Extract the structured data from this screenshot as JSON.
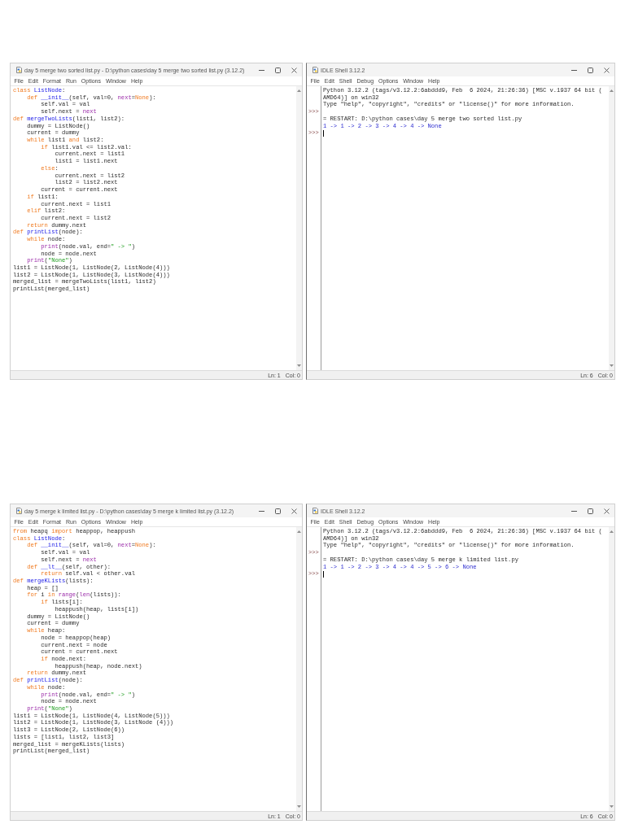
{
  "screens": [
    {
      "editor": {
        "title": "day 5 merge two sorted list.py - D:\\python cases\\day 5 merge two sorted list.py (3.12.2)",
        "menu": [
          "File",
          "Edit",
          "Format",
          "Run",
          "Options",
          "Window",
          "Help"
        ],
        "code": [
          [
            {
              "text": "class ",
              "kind": "keyword"
            },
            {
              "text": "ListNode",
              "kind": "definition"
            },
            {
              "text": ":",
              "kind": "plain"
            }
          ],
          [
            {
              "text": "    def ",
              "kind": "keyword"
            },
            {
              "text": "__init__",
              "kind": "definition"
            },
            {
              "text": "(self, val=0, ",
              "kind": "plain"
            },
            {
              "text": "next",
              "kind": "builtin"
            },
            {
              "text": "=",
              "kind": "plain"
            },
            {
              "text": "None",
              "kind": "keyword"
            },
            {
              "text": "):",
              "kind": "plain"
            }
          ],
          [
            {
              "text": "        self.val = val",
              "kind": "plain"
            }
          ],
          [
            {
              "text": "        self.next = ",
              "kind": "plain"
            },
            {
              "text": "next",
              "kind": "builtin"
            }
          ],
          [
            {
              "text": "def ",
              "kind": "keyword"
            },
            {
              "text": "mergeTwoLists",
              "kind": "definition"
            },
            {
              "text": "(list1, list2):",
              "kind": "plain"
            }
          ],
          [
            {
              "text": "    dummy = ListNode()",
              "kind": "plain"
            }
          ],
          [
            {
              "text": "    current = dummy",
              "kind": "plain"
            }
          ],
          [
            {
              "text": "    while ",
              "kind": "keyword"
            },
            {
              "text": "list1 ",
              "kind": "plain"
            },
            {
              "text": "and ",
              "kind": "keyword"
            },
            {
              "text": "list2:",
              "kind": "plain"
            }
          ],
          [
            {
              "text": "        if ",
              "kind": "keyword"
            },
            {
              "text": "list1.val <= list2.val:",
              "kind": "plain"
            }
          ],
          [
            {
              "text": "            current.next = list1",
              "kind": "plain"
            }
          ],
          [
            {
              "text": "            list1 = list1.next",
              "kind": "plain"
            }
          ],
          [
            {
              "text": "        else",
              "kind": "keyword"
            },
            {
              "text": ":",
              "kind": "plain"
            }
          ],
          [
            {
              "text": "            current.next = list2",
              "kind": "plain"
            }
          ],
          [
            {
              "text": "            list2 = list2.next",
              "kind": "plain"
            }
          ],
          [
            {
              "text": "        current = current.next",
              "kind": "plain"
            }
          ],
          [
            {
              "text": "    if ",
              "kind": "keyword"
            },
            {
              "text": "list1:",
              "kind": "plain"
            }
          ],
          [
            {
              "text": "        current.next = list1",
              "kind": "plain"
            }
          ],
          [
            {
              "text": "    elif ",
              "kind": "keyword"
            },
            {
              "text": "list2:",
              "kind": "plain"
            }
          ],
          [
            {
              "text": "        current.next = list2",
              "kind": "plain"
            }
          ],
          [
            {
              "text": "    return ",
              "kind": "keyword"
            },
            {
              "text": "dummy.next",
              "kind": "plain"
            }
          ],
          [
            {
              "text": "def ",
              "kind": "keyword"
            },
            {
              "text": "printList",
              "kind": "definition"
            },
            {
              "text": "(node):",
              "kind": "plain"
            }
          ],
          [
            {
              "text": "    while ",
              "kind": "keyword"
            },
            {
              "text": "node:",
              "kind": "plain"
            }
          ],
          [
            {
              "text": "        print",
              "kind": "builtin"
            },
            {
              "text": "(node.val, end=",
              "kind": "plain"
            },
            {
              "text": "\" -> \"",
              "kind": "string"
            },
            {
              "text": ")",
              "kind": "plain"
            }
          ],
          [
            {
              "text": "        node = node.next",
              "kind": "plain"
            }
          ],
          [
            {
              "text": "    print",
              "kind": "builtin"
            },
            {
              "text": "(",
              "kind": "plain"
            },
            {
              "text": "\"None\"",
              "kind": "string"
            },
            {
              "text": ")",
              "kind": "plain"
            }
          ],
          [
            {
              "text": "list1 = ListNode(1, ListNode(2, ListNode(4)))",
              "kind": "plain"
            }
          ],
          [
            {
              "text": "list2 = ListNode(1, ListNode(3, ListNode(4)))",
              "kind": "plain"
            }
          ],
          [
            {
              "text": "merged_list = mergeTwoLists(list1, list2)",
              "kind": "plain"
            }
          ],
          [
            {
              "text": "printList(merged_list)",
              "kind": "plain"
            }
          ]
        ],
        "status": {
          "line": "Ln: 1",
          "column": "Col: 0"
        }
      },
      "shell": {
        "title": "IDLE Shell 3.12.2",
        "menu": [
          "File",
          "Edit",
          "Shell",
          "Debug",
          "Options",
          "Window",
          "Help"
        ],
        "lines": [
          {
            "kind": "console",
            "text": "Python 3.12.2 (tags/v3.12.2:6abddd9, Feb  6 2024, 21:26:36) [MSC v.1937 64 bit ("
          },
          {
            "kind": "console",
            "text": "AMD64)] on win32"
          },
          {
            "kind": "console",
            "text": "Type \"help\", \"copyright\", \"credits\" or \"license()\" for more information."
          },
          {
            "kind": "prompt",
            "text": ">>>"
          },
          {
            "kind": "console",
            "text": "= RESTART: D:\\python cases\\day 5 merge two sorted list.py"
          },
          {
            "kind": "stdout",
            "text": "1 -> 1 -> 2 -> 3 -> 4 -> 4 -> None"
          },
          {
            "kind": "prompt",
            "text": ">>>"
          }
        ],
        "cursor": true,
        "status": {
          "line": "Ln: 6",
          "column": "Col: 0"
        }
      }
    },
    {
      "editor": {
        "title": "day 5 merge k limited list.py - D:\\python cases\\day 5 merge k limited list.py (3.12.2)",
        "menu": [
          "File",
          "Edit",
          "Format",
          "Run",
          "Options",
          "Window",
          "Help"
        ],
        "code": [
          [
            {
              "text": "from ",
              "kind": "keyword"
            },
            {
              "text": "heapq ",
              "kind": "plain"
            },
            {
              "text": "import ",
              "kind": "keyword"
            },
            {
              "text": "heappop, heappush",
              "kind": "plain"
            }
          ],
          [
            {
              "text": "class ",
              "kind": "keyword"
            },
            {
              "text": "ListNode",
              "kind": "definition"
            },
            {
              "text": ":",
              "kind": "plain"
            }
          ],
          [
            {
              "text": "    def ",
              "kind": "keyword"
            },
            {
              "text": "__init__",
              "kind": "definition"
            },
            {
              "text": "(self, val=0, ",
              "kind": "plain"
            },
            {
              "text": "next",
              "kind": "builtin"
            },
            {
              "text": "=",
              "kind": "plain"
            },
            {
              "text": "None",
              "kind": "keyword"
            },
            {
              "text": "):",
              "kind": "plain"
            }
          ],
          [
            {
              "text": "        self.val = val",
              "kind": "plain"
            }
          ],
          [
            {
              "text": "        self.next = ",
              "kind": "plain"
            },
            {
              "text": "next",
              "kind": "builtin"
            }
          ],
          [
            {
              "text": "    def ",
              "kind": "keyword"
            },
            {
              "text": "__lt__",
              "kind": "definition"
            },
            {
              "text": "(self, other):",
              "kind": "plain"
            }
          ],
          [
            {
              "text": "        return ",
              "kind": "keyword"
            },
            {
              "text": "self.val < other.val",
              "kind": "plain"
            }
          ],
          [
            {
              "text": "def ",
              "kind": "keyword"
            },
            {
              "text": "mergeKLists",
              "kind": "definition"
            },
            {
              "text": "(lists):",
              "kind": "plain"
            }
          ],
          [
            {
              "text": "    heap = []",
              "kind": "plain"
            }
          ],
          [
            {
              "text": "    for ",
              "kind": "keyword"
            },
            {
              "text": "i ",
              "kind": "plain"
            },
            {
              "text": "in ",
              "kind": "keyword"
            },
            {
              "text": "range",
              "kind": "builtin"
            },
            {
              "text": "(",
              "kind": "plain"
            },
            {
              "text": "len",
              "kind": "builtin"
            },
            {
              "text": "(lists)):",
              "kind": "plain"
            }
          ],
          [
            {
              "text": "        if ",
              "kind": "keyword"
            },
            {
              "text": "lists[i]:",
              "kind": "plain"
            }
          ],
          [
            {
              "text": "            heappush(heap, lists[i])",
              "kind": "plain"
            }
          ],
          [
            {
              "text": "    dummy = ListNode()",
              "kind": "plain"
            }
          ],
          [
            {
              "text": "    current = dummy",
              "kind": "plain"
            }
          ],
          [
            {
              "text": "    while ",
              "kind": "keyword"
            },
            {
              "text": "heap:",
              "kind": "plain"
            }
          ],
          [
            {
              "text": "        node = heappop(heap)",
              "kind": "plain"
            }
          ],
          [
            {
              "text": "        current.next = node",
              "kind": "plain"
            }
          ],
          [
            {
              "text": "        current = current.next",
              "kind": "plain"
            }
          ],
          [
            {
              "text": "        if ",
              "kind": "keyword"
            },
            {
              "text": "node.next:",
              "kind": "plain"
            }
          ],
          [
            {
              "text": "            heappush(heap, node.next)",
              "kind": "plain"
            }
          ],
          [
            {
              "text": "    return ",
              "kind": "keyword"
            },
            {
              "text": "dummy.next",
              "kind": "plain"
            }
          ],
          [
            {
              "text": "def ",
              "kind": "keyword"
            },
            {
              "text": "printList",
              "kind": "definition"
            },
            {
              "text": "(node):",
              "kind": "plain"
            }
          ],
          [
            {
              "text": "    while ",
              "kind": "keyword"
            },
            {
              "text": "node:",
              "kind": "plain"
            }
          ],
          [
            {
              "text": "        print",
              "kind": "builtin"
            },
            {
              "text": "(node.val, end=",
              "kind": "plain"
            },
            {
              "text": "\" -> \"",
              "kind": "string"
            },
            {
              "text": ")",
              "kind": "plain"
            }
          ],
          [
            {
              "text": "        node = node.next",
              "kind": "plain"
            }
          ],
          [
            {
              "text": "    print",
              "kind": "builtin"
            },
            {
              "text": "(",
              "kind": "plain"
            },
            {
              "text": "\"None\"",
              "kind": "string"
            },
            {
              "text": ")",
              "kind": "plain"
            }
          ],
          [
            {
              "text": "list1 = ListNode(1, ListNode(4, ListNode(5)))",
              "kind": "plain"
            }
          ],
          [
            {
              "text": "list2 = ListNode(1, ListNode(3, ListNode (4)))",
              "kind": "plain"
            }
          ],
          [
            {
              "text": "list3 = ListNode(2, ListNode(6))",
              "kind": "plain"
            }
          ],
          [
            {
              "text": "lists = [list1, list2, list3]",
              "kind": "plain"
            }
          ],
          [
            {
              "text": "merged_list = mergeKLists(lists)",
              "kind": "plain"
            }
          ],
          [
            {
              "text": "printList(merged_list)",
              "kind": "plain"
            }
          ]
        ],
        "status": {
          "line": "Ln: 1",
          "column": "Col: 0"
        }
      },
      "shell": {
        "title": "IDLE Shell 3.12.2",
        "menu": [
          "File",
          "Edit",
          "Shell",
          "Debug",
          "Options",
          "Window",
          "Help"
        ],
        "lines": [
          {
            "kind": "console",
            "text": "Python 3.12.2 (tags/v3.12.2:6abddd9, Feb  6 2024, 21:26:36) [MSC v.1937 64 bit ("
          },
          {
            "kind": "console",
            "text": "AMD64)] on win32"
          },
          {
            "kind": "console",
            "text": "Type \"help\", \"copyright\", \"credits\" or \"license()\" for more information."
          },
          {
            "kind": "prompt",
            "text": ">>>"
          },
          {
            "kind": "console",
            "text": "= RESTART: D:\\python cases\\day 5 merge k limited list.py"
          },
          {
            "kind": "stdout",
            "text": "1 -> 1 -> 2 -> 3 -> 4 -> 4 -> 5 -> 6 -> None"
          },
          {
            "kind": "prompt",
            "text": ">>>"
          }
        ],
        "cursor": true,
        "status": {
          "line": "Ln: 6",
          "column": "Col: 0"
        }
      }
    }
  ]
}
